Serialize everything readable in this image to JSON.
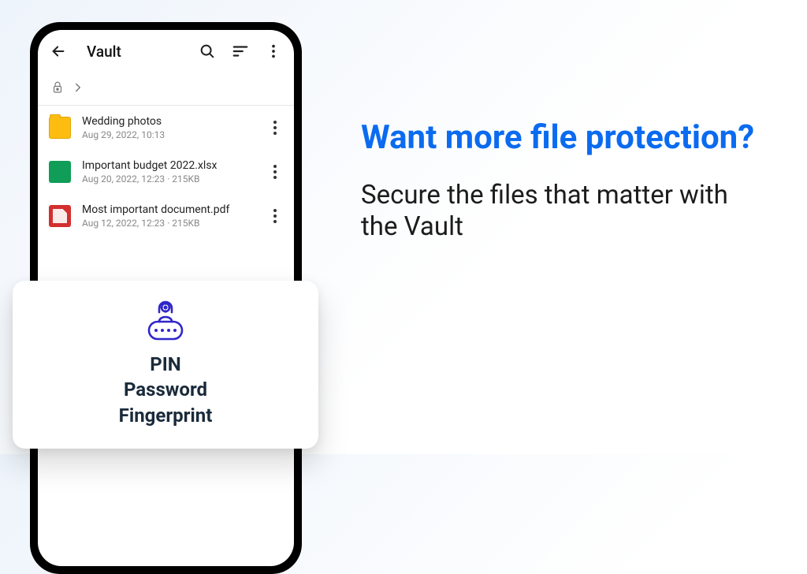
{
  "phone": {
    "title": "Vault",
    "items": [
      {
        "name": "Wedding photos",
        "meta": "Aug 29, 2022, 10:13",
        "kind": "folder"
      },
      {
        "name": "Important budget 2022.xlsx",
        "meta": "Aug 20, 2022, 12:23 · 215KB",
        "kind": "sheet"
      },
      {
        "name": "Most important document.pdf",
        "meta": "Aug 12, 2022, 12:23 · 215KB",
        "kind": "pdf"
      }
    ]
  },
  "card": {
    "lines": [
      "PIN",
      "Password",
      "Fingerprint"
    ]
  },
  "copy": {
    "headline": "Want more file protection?",
    "sub": "Secure the files that matter with the Vault"
  },
  "colors": {
    "accent_blue": "#0b6bf0",
    "card_icon": "#3026c9"
  }
}
